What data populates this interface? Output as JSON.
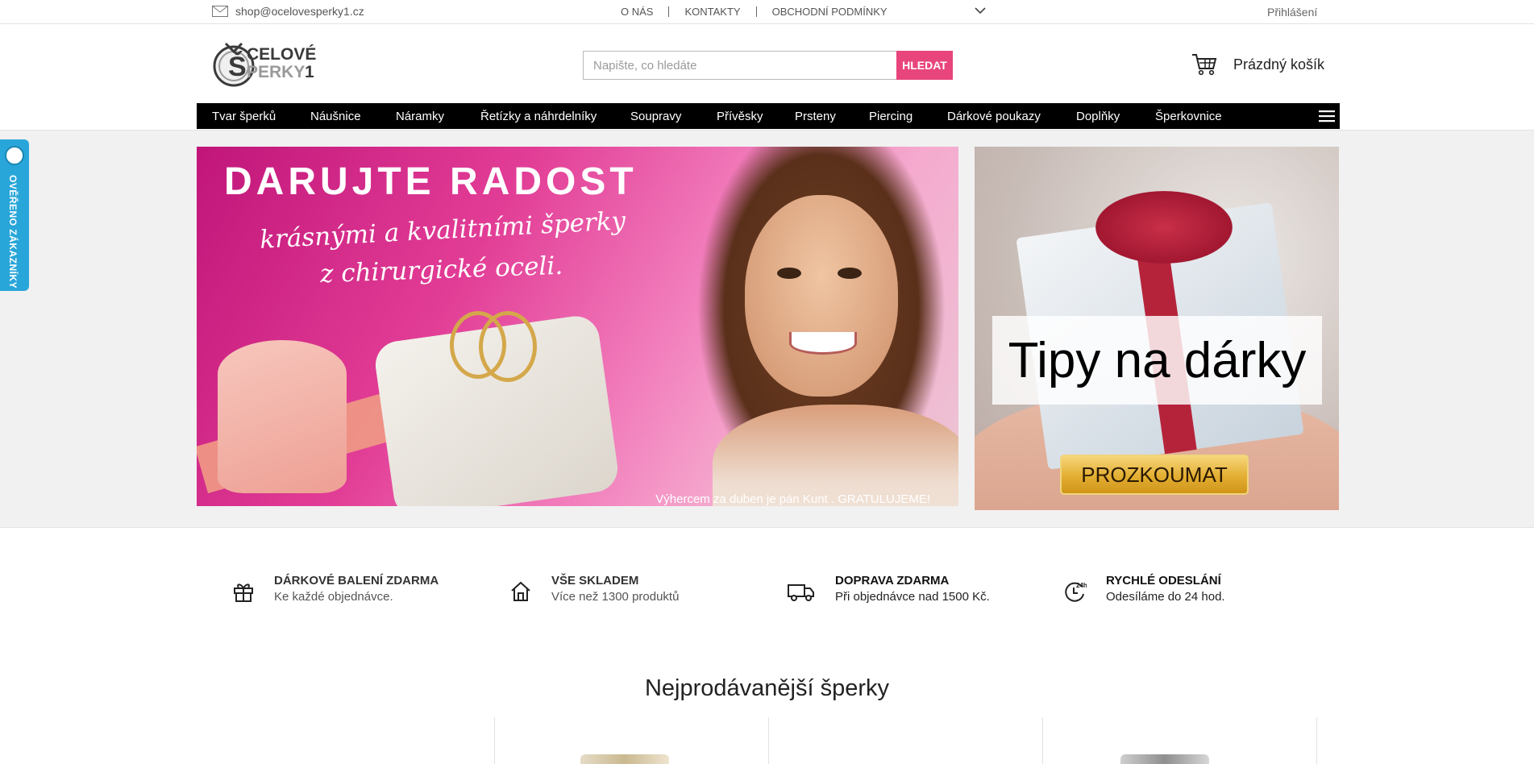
{
  "topbar": {
    "email": "shop@ocelovesperky1.cz",
    "links": [
      "O NÁS",
      "KONTAKTY",
      "OBCHODNÍ PODMÍNKY"
    ],
    "login": "Přihlášení"
  },
  "header": {
    "logo": "OCELOVÉ ŠPERKY1",
    "search_placeholder": "Napište, co hledáte",
    "search_button": "HLEDAT",
    "cart_label": "Prázdný košík"
  },
  "nav": {
    "items": [
      "Tvar šperků",
      "Náušnice",
      "Náramky",
      "Řetízky a náhrdelníky",
      "Soupravy",
      "Přívěsky",
      "Prsteny",
      "Piercing",
      "Dárkové poukazy",
      "Doplňky",
      "Šperkovnice"
    ]
  },
  "banner_left": {
    "title": "DARUJTE RADOST",
    "line1": "krásnými a kvalitními šperky",
    "line2": "z chirurgické oceli.",
    "caption": "Výhercem za duben je pán Kunt . GRATULUJEME!"
  },
  "banner_right": {
    "title": "Tipy na dárky",
    "button": "PROZKOUMAT"
  },
  "verified_badge": "OVĚŘENO ZÁKAZNÍKY",
  "features": [
    {
      "title": "DÁRKOVÉ BALENÍ ZDARMA",
      "desc": "Ke každé objednávce."
    },
    {
      "title": "VŠE SKLADEM",
      "desc": "Více než 1300 produktů"
    },
    {
      "title": "DOPRAVA ZDARMA",
      "desc": "Při objednávce nad 1500 Kč."
    },
    {
      "title": "RYCHLÉ ODESLÁNÍ",
      "desc": "Odesíláme do 24 hod.",
      "icon_text": "24h"
    }
  ],
  "bestsellers_title": "Nejprodávanější šperky",
  "colors": {
    "accent": "#e8457c",
    "nav_bg": "#000000",
    "badge": "#29a6d9",
    "cta_gold": "#e3ae32"
  },
  "icons": [
    "mail-icon",
    "chevron-down-icon",
    "cart-icon",
    "menu-icon",
    "gift-icon",
    "home-icon",
    "truck-icon",
    "clock-24-icon"
  ]
}
